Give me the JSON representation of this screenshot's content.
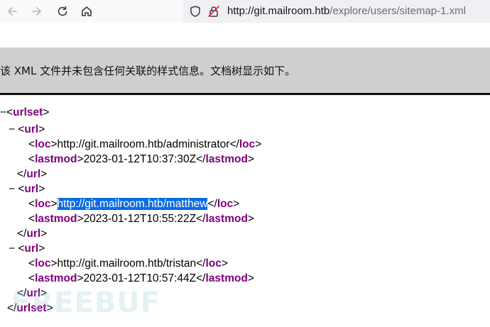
{
  "browser": {
    "url_host": "http://git.mailroom.htb",
    "url_path": "/explore/users/sitemap-1.xml"
  },
  "banner": {
    "message": "该 XML 文件并未包含任何关联的样式信息。文档树显示如下。"
  },
  "xml": {
    "toggle_symbol": "−",
    "root_tag": "urlset",
    "url_tag": "url",
    "loc_tag": "loc",
    "lastmod_tag": "lastmod",
    "entries": [
      {
        "loc": "http://git.mailroom.htb/administrator",
        "lastmod": "2023-01-12T10:37:30Z"
      },
      {
        "loc": "http://git.mailroom.htb/matthew",
        "lastmod": "2023-01-12T10:55:22Z"
      },
      {
        "loc": "http://git.mailroom.htb/tristan",
        "lastmod": "2023-01-12T10:57:44Z"
      }
    ]
  },
  "watermark": "FREEBUF"
}
